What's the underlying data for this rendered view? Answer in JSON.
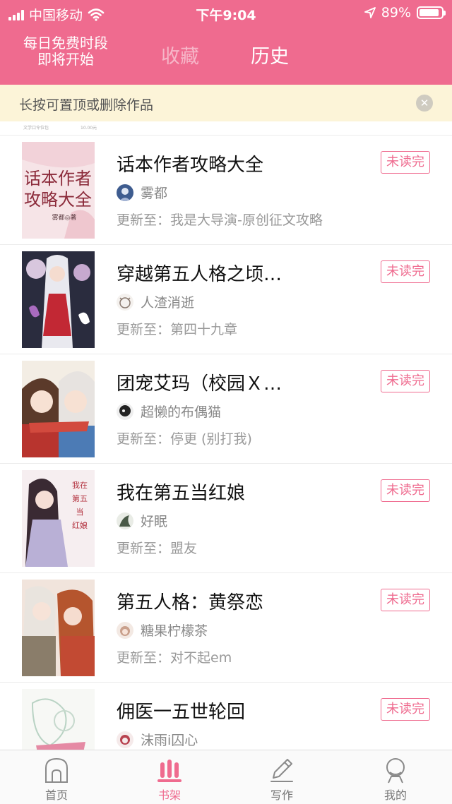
{
  "status_bar": {
    "carrier": "中国移动",
    "time": "下午9:04",
    "battery": "89%",
    "battery_level": 0.89,
    "icons": [
      "signal-icon",
      "wifi-icon",
      "location-icon",
      "battery-icon"
    ]
  },
  "header": {
    "free_time_line1": "每日免费时段",
    "free_time_line2": "即将开始",
    "tab_favorites": "收藏",
    "tab_history": "历史"
  },
  "notice": {
    "text": "长按可置顶或删除作品",
    "close_icon": "close-icon"
  },
  "partial_row": {
    "left_text": "文学口令位包",
    "right_text": "10.00元"
  },
  "books": [
    {
      "title": "话本作者攻略大全",
      "author": "雾都",
      "update": "更新至：我是大导演-原创征文攻略",
      "badge": "未读完",
      "cover_text": "话本作者攻略大全",
      "cover_subtext": "雾都◎著"
    },
    {
      "title": "穿越第五人格之顷…",
      "author": "人渣消逝",
      "update": "更新至：第四十九章",
      "badge": "未读完"
    },
    {
      "title": "团宠艾玛（校园Ｘ…",
      "author": "超懒的布偶猫",
      "update": "更新至：停更 (别打我)",
      "badge": "未读完"
    },
    {
      "title": "我在第五当红娘",
      "author": "好眠",
      "update": "更新至：盟友",
      "badge": "未读完",
      "cover_text": "我在第五当红娘"
    },
    {
      "title": "第五人格：黄祭恋",
      "author": "糖果柠檬茶",
      "update": "更新至：对不起em",
      "badge": "未读完"
    },
    {
      "title": "佣医一五世轮回",
      "author": "沫雨i囚心",
      "update": "",
      "badge": "未读完"
    }
  ],
  "tabbar": {
    "home": "首页",
    "bookshelf": "书架",
    "write": "写作",
    "mine": "我的",
    "active_tab": "书架",
    "active_color": "#ef6b8f"
  },
  "colors": {
    "brand_pink": "#ef6b8f",
    "notice_bg": "#fcf4d8"
  }
}
